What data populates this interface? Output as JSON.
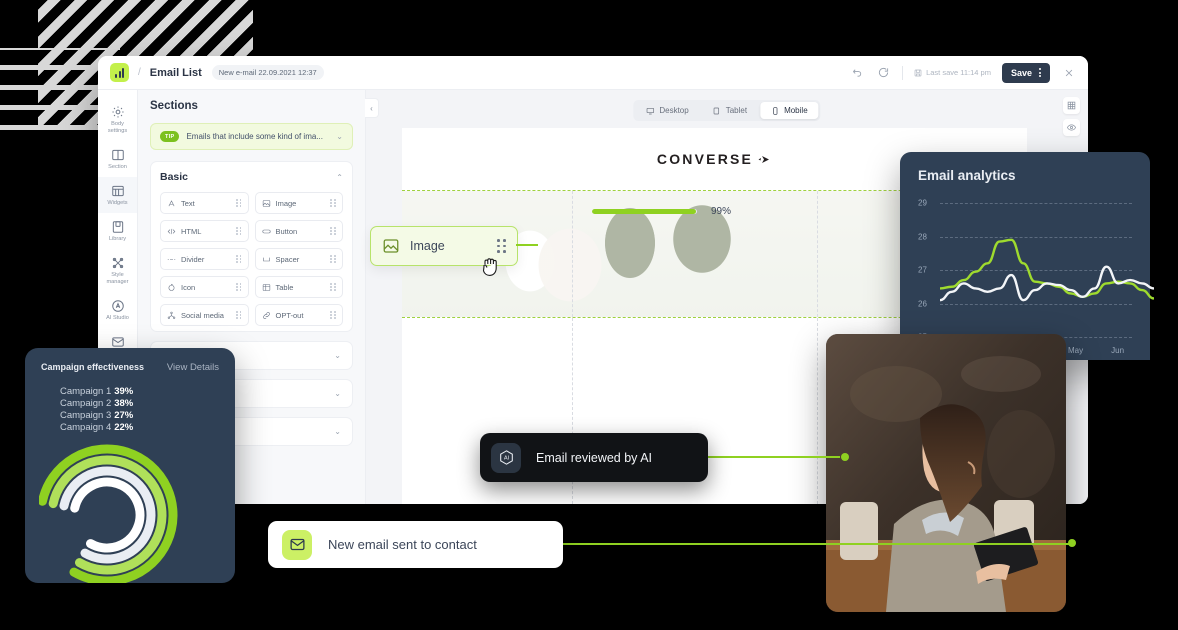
{
  "app": {
    "breadcrumb_separator": "/",
    "title": "Email List",
    "chip": "New e-mail 22.09.2021 12:37",
    "last_save": "Last save 11:14 pm",
    "save_label": "Save"
  },
  "rail": {
    "items": [
      {
        "label": "Body\nsettings",
        "icon": "gear-icon",
        "name": "body-settings"
      },
      {
        "label": "Section",
        "icon": "columns-icon",
        "name": "section"
      },
      {
        "label": "Widgets",
        "icon": "widgets-icon",
        "name": "widgets"
      },
      {
        "label": "Library",
        "icon": "library-icon",
        "name": "library"
      },
      {
        "label": "Style\nmanager",
        "icon": "style-icon",
        "name": "style-manager"
      },
      {
        "label": "AI Studio",
        "icon": "ai-icon",
        "name": "ai-studio"
      },
      {
        "label": "Sending\nsettings",
        "icon": "envelope-icon",
        "name": "sending-settings"
      }
    ]
  },
  "panel": {
    "title": "Sections",
    "tip": {
      "badge": "TIP",
      "text": "Emails that include some kind of ima..."
    },
    "basic": {
      "title": "Basic",
      "widgets": [
        {
          "label": "Text",
          "icon": "text-icon"
        },
        {
          "label": "Image",
          "icon": "image-icon"
        },
        {
          "label": "HTML",
          "icon": "code-icon"
        },
        {
          "label": "Button",
          "icon": "button-icon"
        },
        {
          "label": "Divider",
          "icon": "divider-icon"
        },
        {
          "label": "Spacer",
          "icon": "spacer-icon"
        },
        {
          "label": "Icon",
          "icon": "icon-icon"
        },
        {
          "label": "Table",
          "icon": "table-icon"
        },
        {
          "label": "Social media",
          "icon": "social-icon"
        },
        {
          "label": "OPT-out",
          "icon": "optout-icon"
        }
      ]
    },
    "collapsed_groups": [
      {
        "label": ""
      },
      {
        "label": ""
      },
      {
        "label": ""
      }
    ]
  },
  "canvas": {
    "devices": [
      {
        "label": "Desktop",
        "icon": "desktop-icon",
        "active": false
      },
      {
        "label": "Tablet",
        "icon": "tablet-icon",
        "active": false
      },
      {
        "label": "Mobile",
        "icon": "mobile-icon",
        "active": true
      }
    ],
    "tools": [
      "grid-icon",
      "eye-icon"
    ],
    "brand": "CONVERSE",
    "progress": {
      "value": 99,
      "label": "99%"
    }
  },
  "drag_card": {
    "label": "Image",
    "icon": "image-icon"
  },
  "analytics": {
    "title": "Email analytics"
  },
  "campaign": {
    "title": "Campaign effectiveness",
    "link": "View Details",
    "rows": [
      {
        "label": "Campaign 1",
        "value": "39%"
      },
      {
        "label": "Campaign 2",
        "value": "38%"
      },
      {
        "label": "Campaign 3",
        "value": "27%"
      },
      {
        "label": "Campaign 4",
        "value": "22%"
      }
    ]
  },
  "ai_pill": {
    "label": "Email reviewed by AI",
    "icon": "ai-hex-icon"
  },
  "email_card": {
    "label": "New email sent to contact",
    "icon": "envelope-icon"
  },
  "chart_data": [
    {
      "type": "line",
      "title": "Email analytics",
      "xlabel": "",
      "ylabel": "",
      "ylim": [
        25,
        29
      ],
      "ytick_labels": [
        "29",
        "28",
        "27",
        "26",
        "25"
      ],
      "xtick_labels": [
        "May",
        "Jun"
      ],
      "grid": true,
      "legend": "none",
      "x": [
        0,
        1,
        2,
        3,
        4,
        5,
        6,
        7,
        8,
        9,
        10,
        11,
        12,
        13,
        14,
        15,
        16,
        17,
        18
      ],
      "series": [
        {
          "name": "series-green",
          "color": "#9fdb2e",
          "values": [
            26.45,
            26.5,
            26.7,
            26.95,
            27.2,
            27.85,
            27.9,
            27.2,
            26.65,
            26.6,
            26.5,
            26.3,
            26.2,
            26.3,
            26.6,
            26.65,
            26.6,
            26.4,
            26.15
          ]
        },
        {
          "name": "series-white",
          "color": "#f3f5f8",
          "values": [
            26.1,
            26.35,
            26.6,
            26.45,
            26.35,
            26.45,
            26.85,
            26.1,
            26.4,
            26.6,
            26.55,
            26.4,
            26.2,
            26.45,
            27.1,
            26.6,
            26.7,
            26.6,
            26.45
          ]
        }
      ]
    },
    {
      "type": "bar",
      "subtype": "radial",
      "title": "Campaign effectiveness",
      "categories": [
        "Campaign 1",
        "Campaign 2",
        "Campaign 3",
        "Campaign 4"
      ],
      "values": [
        39,
        38,
        27,
        22
      ],
      "colors": [
        "#8fd121",
        "#b0e05a",
        "#e9edf3",
        "#ffffff"
      ],
      "unit": "%"
    },
    {
      "type": "bar",
      "subtype": "progress",
      "title": "",
      "categories": [
        "progress"
      ],
      "values": [
        99
      ],
      "unit": "%"
    }
  ],
  "colors": {
    "accent_green": "#8fd121",
    "lime": "#ccf065",
    "dark_navy": "#2f4055",
    "ink": "#2b3445"
  }
}
